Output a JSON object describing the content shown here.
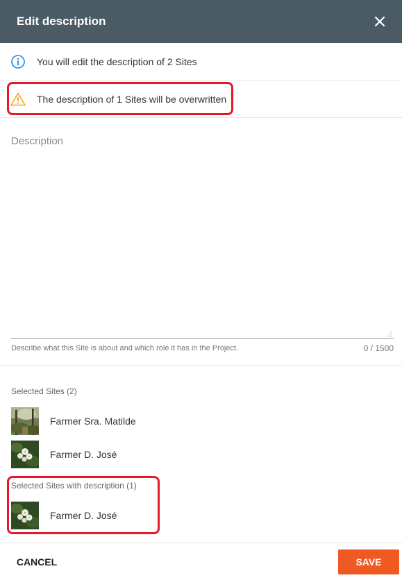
{
  "dialog": {
    "title": "Edit description",
    "close_icon": "close-icon"
  },
  "info": {
    "icon": "info-icon",
    "text": "You will edit the description of 2 Sites",
    "color": "#1e88e5"
  },
  "warning": {
    "icon": "warning-icon",
    "text": "The description of 1 Sites will be overwritten",
    "color": "#f5a623",
    "highlight_color": "#e8182b"
  },
  "description": {
    "label": "Description",
    "value": "",
    "helper": "Describe what this Site is about and which role it has in the Project.",
    "counter": "0 / 1500"
  },
  "selected_sites": {
    "label": "Selected Sites (2)",
    "items": [
      {
        "name": "Farmer Sra. Matilde",
        "thumbnail": "forest-photo"
      },
      {
        "name": "Farmer D. José",
        "thumbnail": "flower-photo"
      }
    ]
  },
  "sites_with_description": {
    "label": "Selected Sites with description (1)",
    "items": [
      {
        "name": "Farmer D. José",
        "thumbnail": "flower-photo"
      }
    ]
  },
  "footer": {
    "cancel_label": "CANCEL",
    "save_label": "SAVE",
    "save_color": "#f05a22"
  }
}
